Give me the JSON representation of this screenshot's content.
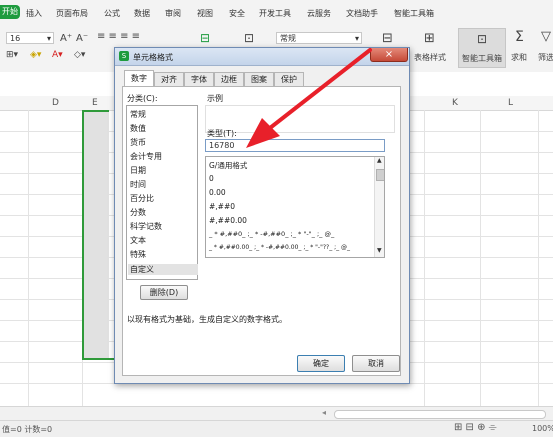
{
  "menubar": {
    "start_tab": "开始",
    "items": [
      "插入",
      "页面布局",
      "公式",
      "数据",
      "审阅",
      "视图",
      "安全",
      "开发工具",
      "云服务",
      "文档助手",
      "智能工具箱"
    ]
  },
  "toolbar": {
    "font_size": "16",
    "font_grow": "A⁺",
    "font_shrink": "A⁻",
    "number_format": "常规",
    "table_style": "表格样式",
    "smart_toolbox": "智能工具箱",
    "sum": "求和",
    "filter": "筛选"
  },
  "columns": [
    "D",
    "E",
    "K",
    "L"
  ],
  "dialog": {
    "title": "单元格格式",
    "close_label": "×",
    "tabs": [
      "数字",
      "对齐",
      "字体",
      "边框",
      "图案",
      "保护"
    ],
    "category_label": "分类(C):",
    "categories": [
      "常规",
      "数值",
      "货币",
      "会计专用",
      "日期",
      "时间",
      "百分比",
      "分数",
      "科学记数",
      "文本",
      "特殊",
      "自定义"
    ],
    "selected_category": "自定义",
    "sample_label": "示例",
    "type_label": "类型(T):",
    "type_value": "16780",
    "formats": [
      "G/通用格式",
      "0",
      "0.00",
      "#,##0",
      "#,##0.00",
      "_ * #,##0_ ;_ * -#,##0_ ;_ * \"-\"_ ;_ @_",
      "_ * #,##0.00_ ;_ * -#,##0.00_ ;_ * \"-\"??_ ;_ @_"
    ],
    "delete_label": "删除(D)",
    "description": "以现有格式为基础，生成自定义的数字格式。",
    "ok_label": "确定",
    "cancel_label": "取消"
  },
  "status": {
    "left": "值=0  计数=0",
    "zoom": "100%"
  },
  "colors": {
    "accent": "#1e9b3e",
    "arrow": "#e8202a",
    "selection": "#2f9a3a"
  }
}
